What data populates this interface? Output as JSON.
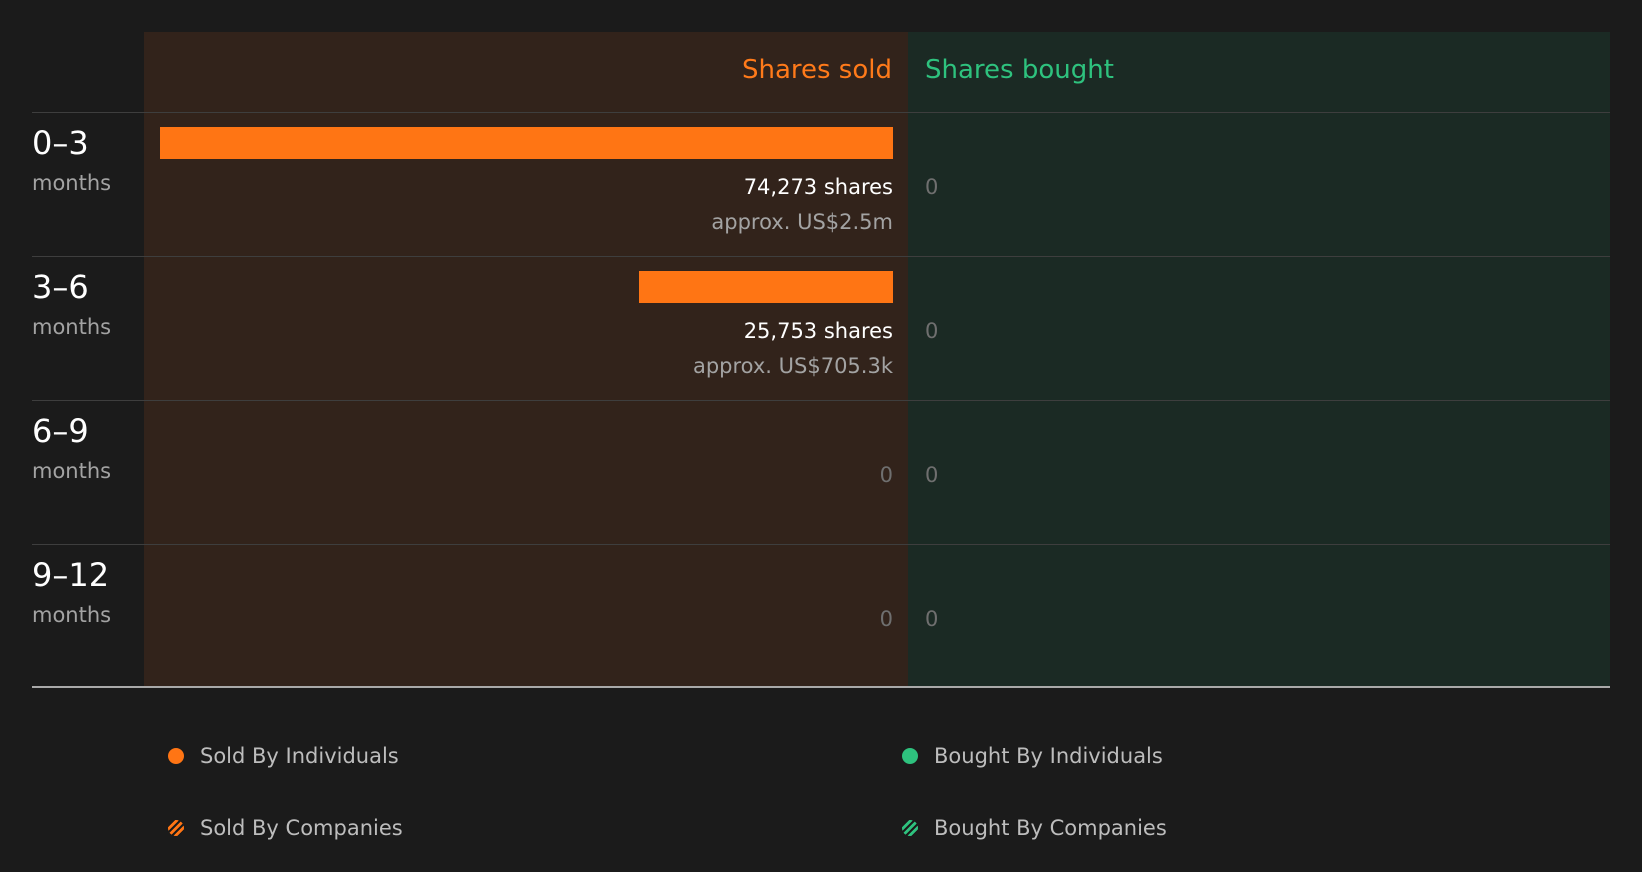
{
  "chart_data": {
    "type": "bar",
    "headers": {
      "sold": "Shares sold",
      "bought": "Shares bought"
    },
    "categories": [
      {
        "range": "0–3",
        "unit": "months"
      },
      {
        "range": "3–6",
        "unit": "months"
      },
      {
        "range": "6–9",
        "unit": "months"
      },
      {
        "range": "9–12",
        "unit": "months"
      }
    ],
    "series": [
      {
        "name": "Shares sold",
        "values": [
          74273,
          25753,
          0,
          0
        ],
        "labels": [
          "74,273 shares",
          "25,753 shares",
          "0",
          "0"
        ],
        "value_labels": [
          "approx. US$2.5m",
          "approx. US$705.3k",
          "",
          ""
        ]
      },
      {
        "name": "Shares bought",
        "values": [
          0,
          0,
          0,
          0
        ],
        "labels": [
          "0",
          "0",
          "0",
          "0"
        ]
      }
    ],
    "legend": [
      {
        "label": "Sold By Individuals",
        "style": "dot",
        "color": "#ff7514"
      },
      {
        "label": "Bought By Individuals",
        "style": "dot",
        "color": "#2ec27e"
      },
      {
        "label": "Sold By Companies",
        "style": "hatch",
        "color": "#ff7514"
      },
      {
        "label": "Bought By Companies",
        "style": "hatch",
        "color": "#2ec27e"
      }
    ],
    "colors": {
      "sold": "#ff7514",
      "bought": "#2ec27e",
      "sold_panel": "#32231b",
      "bought_panel": "#1b2a24"
    }
  }
}
